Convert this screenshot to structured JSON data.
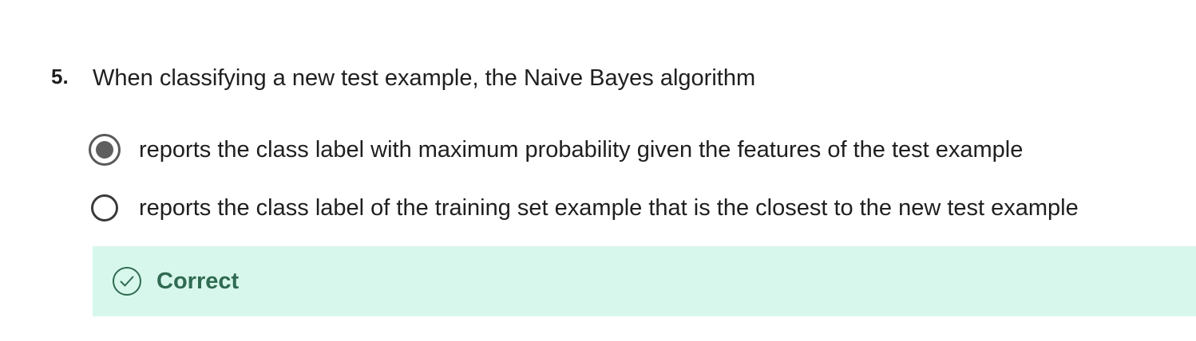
{
  "question": {
    "number": "5.",
    "text": "When classifying a new test example, the Naive Bayes algorithm"
  },
  "options": [
    {
      "label": "reports the class label with maximum probability given the features of the test example",
      "selected": true
    },
    {
      "label": "reports the class label of the training set example that is the closest to the new test example",
      "selected": false
    }
  ],
  "feedback": {
    "status": "Correct",
    "icon": "check-circle-icon"
  },
  "colors": {
    "feedback_bg": "#d8f7ec",
    "feedback_text": "#2f6b52",
    "radio_border": "#3a3a3a",
    "radio_fill": "#5f5f5f"
  }
}
